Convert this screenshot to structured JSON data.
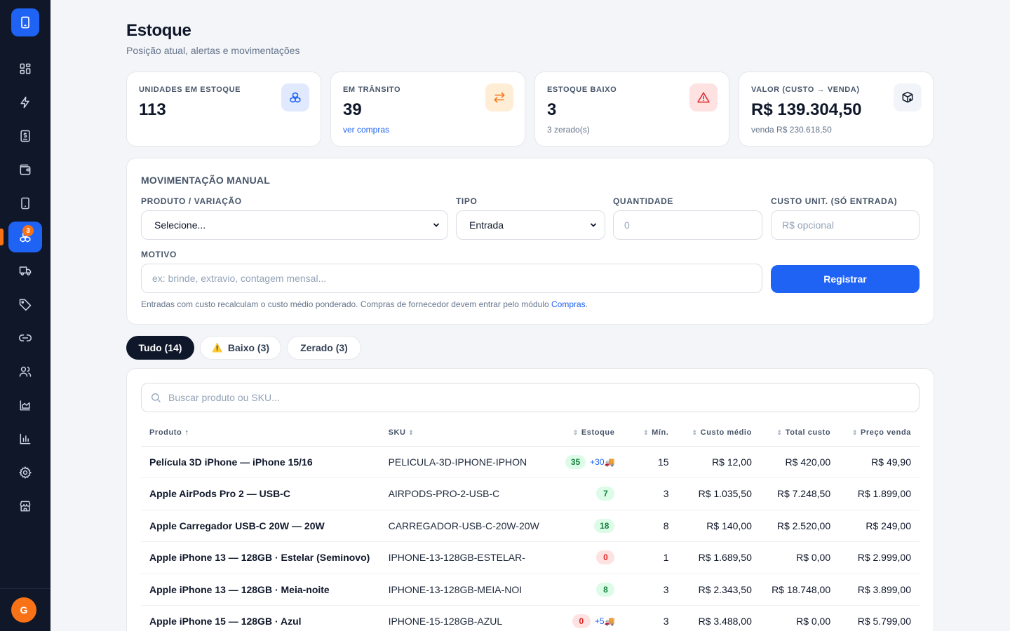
{
  "sidebar": {
    "items": [
      {
        "icon": "grid-icon",
        "name": "sidebar-item-dashboard"
      },
      {
        "icon": "zap-icon",
        "name": "sidebar-item-quick"
      },
      {
        "icon": "dollar-receipt-icon",
        "name": "sidebar-item-sales"
      },
      {
        "icon": "wallet-icon",
        "name": "sidebar-item-wallet"
      },
      {
        "icon": "phone-icon",
        "name": "sidebar-item-products"
      },
      {
        "icon": "boxes-icon",
        "name": "sidebar-item-stock",
        "active": true,
        "badge": "3"
      },
      {
        "icon": "truck-icon",
        "name": "sidebar-item-purchases"
      },
      {
        "icon": "tag-icon",
        "name": "sidebar-item-tags"
      },
      {
        "icon": "link-icon",
        "name": "sidebar-item-links"
      },
      {
        "icon": "users-icon",
        "name": "sidebar-item-customers"
      },
      {
        "icon": "area-chart-icon",
        "name": "sidebar-item-reports-area"
      },
      {
        "icon": "bar-chart-icon",
        "name": "sidebar-item-reports"
      },
      {
        "icon": "gear-icon",
        "name": "sidebar-item-settings"
      },
      {
        "icon": "store-icon",
        "name": "sidebar-item-store"
      }
    ],
    "avatar_initial": "G"
  },
  "header": {
    "title": "Estoque",
    "subtitle": "Posição atual, alertas e movimentações"
  },
  "stats": [
    {
      "label": "UNIDADES EM ESTOQUE",
      "value": "113",
      "sub": "",
      "icon": "boxes-icon",
      "color": "#1f63f5"
    },
    {
      "label": "EM TRÂNSITO",
      "value": "39",
      "sub": "ver compras",
      "icon": "arrows-swap-icon",
      "color": "#f97316"
    },
    {
      "label": "ESTOQUE BAIXO",
      "value": "3",
      "sub": "3 zerado(s)",
      "icon": "warning-icon",
      "color": "#dc2626"
    },
    {
      "label": "VALOR (CUSTO → VENDA)",
      "value": "R$ 139.304,50",
      "sub": "venda R$ 230.618,50",
      "icon": "box-x-icon",
      "color": "#0f172a"
    }
  ],
  "manual": {
    "title": "MOVIMENTAÇÃO MANUAL",
    "product_label": "PRODUTO / VARIAÇÃO",
    "product_value": "Selecione...",
    "type_label": "TIPO",
    "type_value": "Entrada",
    "qty_label": "QUANTIDADE",
    "qty_placeholder": "0",
    "cost_label": "CUSTO UNIT. (SÓ ENTRADA)",
    "cost_placeholder": "R$ opcional",
    "reason_label": "MOTIVO",
    "reason_placeholder": "ex: brinde, extravio, contagem mensal...",
    "submit": "Registrar",
    "help": "Entradas com custo recalculam o custo médio ponderado. Compras de fornecedor devem entrar pelo módulo",
    "help_link": "Compras",
    "help_end": "."
  },
  "filters": [
    {
      "label": "Tudo (14)",
      "active": true
    },
    {
      "label": "Baixo (3)",
      "active": false,
      "emoji": "⚠️"
    },
    {
      "label": "Zerado (3)",
      "active": false
    }
  ],
  "table": {
    "search_placeholder": "Buscar produto ou SKU...",
    "columns": [
      "Produto",
      "SKU",
      "Estoque",
      "Mín.",
      "Custo médio",
      "Total custo",
      "Preço venda"
    ],
    "rows": [
      {
        "product": "Película 3D iPhone — iPhone 15/16",
        "sku": "PELICULA-3D-IPHONE-IPHON",
        "stock": "35",
        "transit": "+30🚚",
        "status": "ok",
        "min": "15",
        "avg_cost": "R$ 12,00",
        "total_cost": "R$ 420,00",
        "price": "R$ 49,90"
      },
      {
        "product": "Apple AirPods Pro 2 — USB-C",
        "sku": "AIRPODS-PRO-2-USB-C",
        "stock": "7",
        "transit": "",
        "status": "ok",
        "min": "3",
        "avg_cost": "R$ 1.035,50",
        "total_cost": "R$ 7.248,50",
        "price": "R$ 1.899,00"
      },
      {
        "product": "Apple Carregador USB-C 20W — 20W",
        "sku": "CARREGADOR-USB-C-20W-20W",
        "stock": "18",
        "transit": "",
        "status": "ok",
        "min": "8",
        "avg_cost": "R$ 140,00",
        "total_cost": "R$ 2.520,00",
        "price": "R$ 249,00"
      },
      {
        "product": "Apple iPhone 13 — 128GB · Estelar (Seminovo)",
        "sku": "IPHONE-13-128GB-ESTELAR-",
        "stock": "0",
        "transit": "",
        "status": "zero",
        "min": "1",
        "avg_cost": "R$ 1.689,50",
        "total_cost": "R$ 0,00",
        "price": "R$ 2.999,00"
      },
      {
        "product": "Apple iPhone 13 — 128GB · Meia-noite",
        "sku": "IPHONE-13-128GB-MEIA-NOI",
        "stock": "8",
        "transit": "",
        "status": "ok",
        "min": "3",
        "avg_cost": "R$ 2.343,50",
        "total_cost": "R$ 18.748,00",
        "price": "R$ 3.899,00"
      },
      {
        "product": "Apple iPhone 15 — 128GB · Azul",
        "sku": "IPHONE-15-128GB-AZUL",
        "stock": "0",
        "transit": "+5🚚",
        "status": "zero",
        "min": "3",
        "avg_cost": "R$ 3.488,00",
        "total_cost": "R$ 0,00",
        "price": "R$ 5.799,00"
      }
    ]
  }
}
